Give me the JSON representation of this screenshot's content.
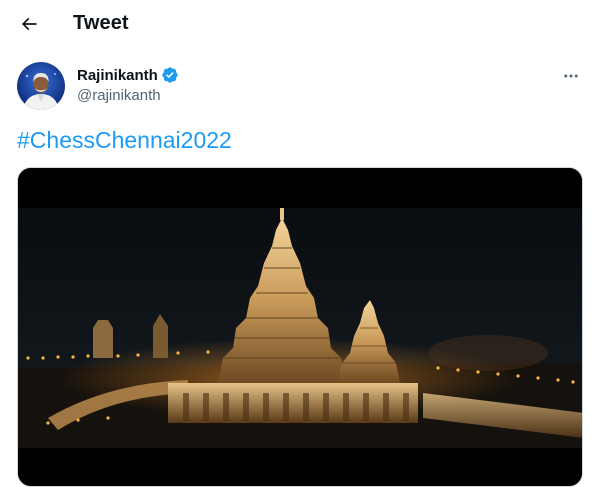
{
  "header": {
    "title": "Tweet",
    "back_icon": "arrow-left-icon"
  },
  "author": {
    "display_name": "Rajinikanth",
    "handle": "@rajinikanth",
    "verified_icon": "verified-badge-icon",
    "verified_color": "#1d9bf0",
    "more_icon": "more-horizontal-icon"
  },
  "tweet": {
    "text": "#ChessChennai2022",
    "link_color": "#1d9bf0"
  },
  "media": {
    "kind": "image",
    "subject": "illuminated-temple"
  }
}
